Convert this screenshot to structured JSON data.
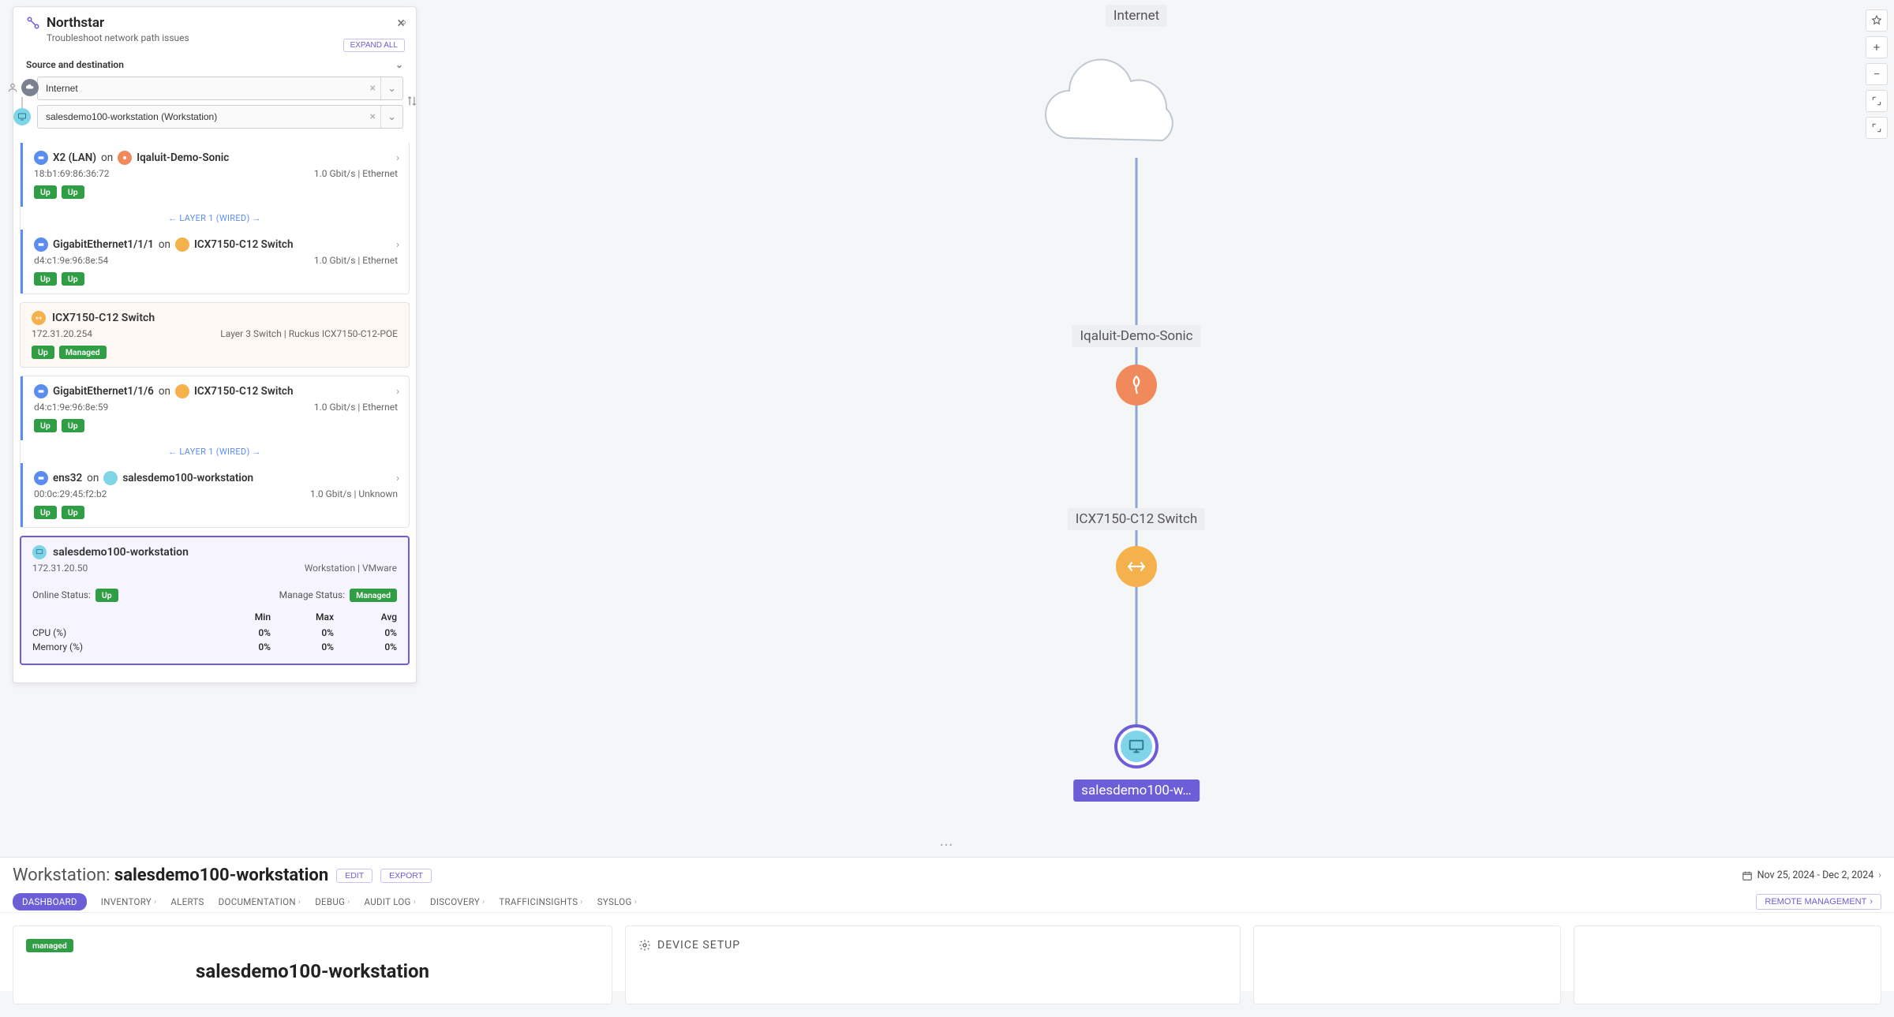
{
  "panel": {
    "title": "Northstar",
    "subtitle": "Troubleshoot network path issues",
    "expand_all": "EXPAND ALL",
    "section_label": "Source and destination",
    "source_value": "Internet",
    "dest_value": "salesdemo100-workstation (Workstation)"
  },
  "path": {
    "partial_top": {
      "title_if": "X2 (LAN)",
      "on": "on",
      "device": "Iqaluit-Demo-Sonic",
      "mac": "18:b1:69:86:36:72",
      "speed": "1.0 Gbit/s | Ethernet"
    },
    "layer1a": "LAYER 1 (WIRED)",
    "if2": {
      "title_if": "GigabitEthernet1/1/1",
      "on": "on",
      "device": "ICX7150-C12 Switch",
      "mac": "d4:c1:9e:96:8e:54",
      "speed": "1.0 Gbit/s | Ethernet"
    },
    "switch": {
      "name": "ICX7150-C12 Switch",
      "ip": "172.31.20.254",
      "desc": "Layer 3 Switch | Ruckus ICX7150-C12-POE"
    },
    "if3": {
      "title_if": "GigabitEthernet1/1/6",
      "on": "on",
      "device": "ICX7150-C12 Switch",
      "mac": "d4:c1:9e:96:8e:59",
      "speed": "1.0 Gbit/s | Ethernet"
    },
    "layer1b": "LAYER 1 (WIRED)",
    "if4": {
      "title_if": "ens32",
      "on": "on",
      "device": "salesdemo100-workstation",
      "mac": "00:0c:29:45:f2:b2",
      "speed": "1.0 Gbit/s | Unknown"
    },
    "workstation": {
      "name": "salesdemo100-workstation",
      "ip": "172.31.20.50",
      "desc": "Workstation | VMware",
      "online_label": "Online Status:",
      "online_value": "Up",
      "manage_label": "Manage Status:",
      "manage_value": "Managed",
      "stats": {
        "hdr_min": "Min",
        "hdr_max": "Max",
        "hdr_avg": "Avg",
        "cpu_label": "CPU (%)",
        "cpu_min": "0%",
        "cpu_max": "0%",
        "cpu_avg": "0%",
        "mem_label": "Memory (%)",
        "mem_min": "0%",
        "mem_max": "0%",
        "mem_avg": "0%"
      }
    },
    "badges": {
      "up": "Up",
      "managed": "Managed"
    }
  },
  "topology": {
    "internet": "Internet",
    "node1": "Iqaluit-Demo-Sonic",
    "node2": "ICX7150-C12 Switch",
    "node3": "salesdemo100-w…"
  },
  "bottom": {
    "type_label": "Workstation:",
    "name": "salesdemo100-workstation",
    "edit": "EDIT",
    "export": "EXPORT",
    "date_range": "Nov 25, 2024 - Dec 2, 2024",
    "remote": "REMOTE MANAGEMENT",
    "tabs": [
      "DASHBOARD",
      "INVENTORY",
      "ALERTS",
      "DOCUMENTATION",
      "DEBUG",
      "AUDIT LOG",
      "DISCOVERY",
      "TRAFFICINSIGHTS",
      "SYSLOG"
    ],
    "managed_pill": "managed",
    "big_name": "salesdemo100-workstation",
    "device_setup": "DEVICE SETUP"
  }
}
